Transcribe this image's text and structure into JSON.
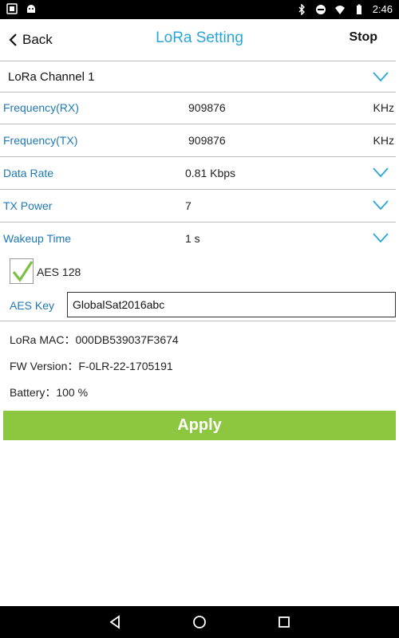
{
  "status_bar": {
    "time": "2:46",
    "icons": [
      "notification-icon",
      "android-icon",
      "bluetooth-icon",
      "do-not-disturb-icon",
      "wifi-icon",
      "battery-icon"
    ]
  },
  "header": {
    "back_label": "Back",
    "title": "LoRa Setting",
    "stop_label": "Stop"
  },
  "channel": {
    "label": "LoRa Channel 1"
  },
  "rows": [
    {
      "label": "Frequency(RX)",
      "value": "909876",
      "unit": "KHz"
    },
    {
      "label": "Frequency(TX)",
      "value": "909876",
      "unit": "KHz"
    },
    {
      "label": "Data Rate",
      "value": "0.81 Kbps"
    },
    {
      "label": "TX Power",
      "value": "7"
    },
    {
      "label": "Wakeup Time",
      "value": "1 s"
    }
  ],
  "aes": {
    "checkbox_label": "AES 128",
    "checked": true,
    "key_label": "AES Key",
    "key_value": "GlobalSat2016abc"
  },
  "info": {
    "mac": "LoRa MAC：000DB539037F3674",
    "fw": "FW Version：F-0LR-22-1705191",
    "battery": "Battery：100 %"
  },
  "apply_label": "Apply",
  "colors": {
    "accent_blue": "#2aa6d8",
    "label_blue": "#1f78b4",
    "apply_green": "#8dc63f",
    "check_green": "#7cc242"
  }
}
